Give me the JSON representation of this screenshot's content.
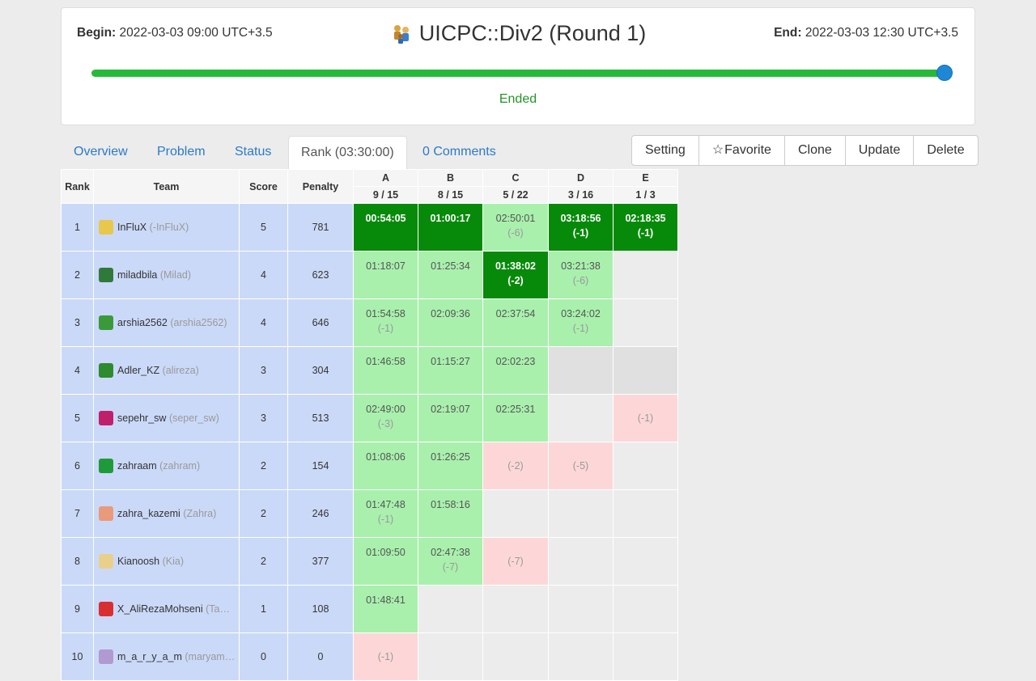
{
  "contest": {
    "begin_label": "Begin:",
    "begin_value": "2022-03-03 09:00 UTC+3.5",
    "end_label": "End:",
    "end_value": "2022-03-03 12:30 UTC+3.5",
    "title": "UICPC::Div2 (Round 1)",
    "status": "Ended",
    "progress_fraction": 1.0
  },
  "tabs": [
    {
      "label": "Overview"
    },
    {
      "label": "Problem"
    },
    {
      "label": "Status"
    },
    {
      "label": "Rank (03:30:00)"
    },
    {
      "label": "0 Comments"
    }
  ],
  "actions": [
    {
      "label": "Setting"
    },
    {
      "label": "Favorite"
    },
    {
      "label": "Clone"
    },
    {
      "label": "Update"
    },
    {
      "label": "Delete"
    }
  ],
  "table": {
    "headers": {
      "rank": "Rank",
      "team": "Team",
      "score": "Score",
      "penalty": "Penalty"
    },
    "problems": [
      {
        "letter": "A",
        "stat": "9 / 15"
      },
      {
        "letter": "B",
        "stat": "8 / 15"
      },
      {
        "letter": "C",
        "stat": "5 / 22"
      },
      {
        "letter": "D",
        "stat": "3 / 16"
      },
      {
        "letter": "E",
        "stat": "1 / 3"
      }
    ],
    "rows": [
      {
        "rank": "1",
        "name": "InFluX",
        "nick": "(-InFluX)",
        "score": "5",
        "penalty": "781",
        "avatar_color": "#e8c84a",
        "cells": [
          {
            "s": "first",
            "t": "00:54:05",
            "p": ""
          },
          {
            "s": "first",
            "t": "01:00:17",
            "p": ""
          },
          {
            "s": "ok",
            "t": "02:50:01",
            "p": "(-6)"
          },
          {
            "s": "first",
            "t": "03:18:56",
            "p": "(-1)"
          },
          {
            "s": "first",
            "t": "02:18:35",
            "p": "(-1)"
          }
        ]
      },
      {
        "rank": "2",
        "name": "miladbila",
        "nick": "(Milad)",
        "score": "4",
        "penalty": "623",
        "avatar_color": "#2f7a3a",
        "cells": [
          {
            "s": "ok",
            "t": "01:18:07",
            "p": ""
          },
          {
            "s": "ok",
            "t": "01:25:34",
            "p": ""
          },
          {
            "s": "first",
            "t": "01:38:02",
            "p": "(-2)"
          },
          {
            "s": "ok",
            "t": "03:21:38",
            "p": "(-6)"
          },
          {
            "s": "empty",
            "t": "",
            "p": ""
          }
        ]
      },
      {
        "rank": "3",
        "name": "arshia2562",
        "nick": "(arshia2562)",
        "score": "4",
        "penalty": "646",
        "avatar_color": "#3a9a3a",
        "cells": [
          {
            "s": "ok",
            "t": "01:54:58",
            "p": "(-1)"
          },
          {
            "s": "ok",
            "t": "02:09:36",
            "p": ""
          },
          {
            "s": "ok",
            "t": "02:37:54",
            "p": ""
          },
          {
            "s": "ok",
            "t": "03:24:02",
            "p": "(-1)"
          },
          {
            "s": "empty",
            "t": "",
            "p": ""
          }
        ]
      },
      {
        "rank": "4",
        "name": "Adler_KZ",
        "nick": "(alireza)",
        "score": "3",
        "penalty": "304",
        "avatar_color": "#2d8a2d",
        "cells": [
          {
            "s": "ok",
            "t": "01:46:58",
            "p": ""
          },
          {
            "s": "ok",
            "t": "01:15:27",
            "p": ""
          },
          {
            "s": "ok",
            "t": "02:02:23",
            "p": ""
          },
          {
            "s": "pending",
            "t": "",
            "p": ""
          },
          {
            "s": "pending",
            "t": "",
            "p": ""
          }
        ]
      },
      {
        "rank": "5",
        "name": "sepehr_sw",
        "nick": "(seper_sw)",
        "score": "3",
        "penalty": "513",
        "avatar_color": "#c0206a",
        "cells": [
          {
            "s": "ok",
            "t": "02:49:00",
            "p": "(-3)"
          },
          {
            "s": "ok",
            "t": "02:19:07",
            "p": ""
          },
          {
            "s": "ok",
            "t": "02:25:31",
            "p": ""
          },
          {
            "s": "empty",
            "t": "",
            "p": ""
          },
          {
            "s": "fail",
            "t": "",
            "p": "(-1)"
          }
        ]
      },
      {
        "rank": "6",
        "name": "zahraam",
        "nick": "(zahram)",
        "score": "2",
        "penalty": "154",
        "avatar_color": "#1f9a3a",
        "cells": [
          {
            "s": "ok",
            "t": "01:08:06",
            "p": ""
          },
          {
            "s": "ok",
            "t": "01:26:25",
            "p": ""
          },
          {
            "s": "fail",
            "t": "",
            "p": "(-2)"
          },
          {
            "s": "fail",
            "t": "",
            "p": "(-5)"
          },
          {
            "s": "empty",
            "t": "",
            "p": ""
          }
        ]
      },
      {
        "rank": "7",
        "name": "zahra_kazemi",
        "nick": "(Zahra)",
        "score": "2",
        "penalty": "246",
        "avatar_color": "#e89a7a",
        "cells": [
          {
            "s": "ok",
            "t": "01:47:48",
            "p": "(-1)"
          },
          {
            "s": "ok",
            "t": "01:58:16",
            "p": ""
          },
          {
            "s": "empty",
            "t": "",
            "p": ""
          },
          {
            "s": "empty",
            "t": "",
            "p": ""
          },
          {
            "s": "empty",
            "t": "",
            "p": ""
          }
        ]
      },
      {
        "rank": "8",
        "name": "Kianoosh",
        "nick": "(Kia)",
        "score": "2",
        "penalty": "377",
        "avatar_color": "#e8d08a",
        "cells": [
          {
            "s": "ok",
            "t": "01:09:50",
            "p": ""
          },
          {
            "s": "ok",
            "t": "02:47:38",
            "p": "(-7)"
          },
          {
            "s": "fail",
            "t": "",
            "p": "(-7)"
          },
          {
            "s": "empty",
            "t": "",
            "p": ""
          },
          {
            "s": "empty",
            "t": "",
            "p": ""
          }
        ]
      },
      {
        "rank": "9",
        "name": "X_AliRezaMohseni",
        "nick": "(Ta…",
        "score": "1",
        "penalty": "108",
        "avatar_color": "#d83030",
        "cells": [
          {
            "s": "ok",
            "t": "01:48:41",
            "p": ""
          },
          {
            "s": "empty",
            "t": "",
            "p": ""
          },
          {
            "s": "empty",
            "t": "",
            "p": ""
          },
          {
            "s": "empty",
            "t": "",
            "p": ""
          },
          {
            "s": "empty",
            "t": "",
            "p": ""
          }
        ]
      },
      {
        "rank": "10",
        "name": "m_a_r_y_a_m",
        "nick": "(maryam…",
        "score": "0",
        "penalty": "0",
        "avatar_color": "#b09ad0",
        "cells": [
          {
            "s": "fail",
            "t": "",
            "p": "(-1)"
          },
          {
            "s": "empty",
            "t": "",
            "p": ""
          },
          {
            "s": "empty",
            "t": "",
            "p": ""
          },
          {
            "s": "empty",
            "t": "",
            "p": ""
          },
          {
            "s": "empty",
            "t": "",
            "p": ""
          }
        ]
      }
    ]
  },
  "colors": {
    "first_solve": "#078a0a",
    "accepted": "#a9f0ad",
    "rejected": "#fdd7d7",
    "pending": "#e0e0e0",
    "meta_cells": "#cbd9f8",
    "progress": "#27ba3a",
    "knob": "#1e88d6",
    "link": "#2a7ac9"
  },
  "icons": {
    "title": "contest-people-icon",
    "favorite": "star-outline-icon"
  }
}
